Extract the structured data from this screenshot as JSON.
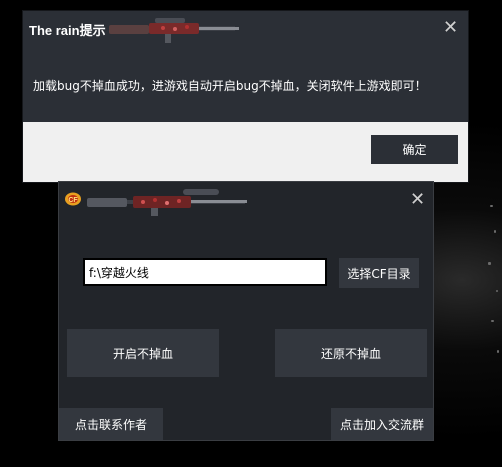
{
  "message_dialog": {
    "title": "The rain提示",
    "message": "加载bug不掉血成功，进游戏自动开启bug不掉血，关闭软件上游戏即可！",
    "ok_label": "确定",
    "close_symbol": "✕"
  },
  "tool_window": {
    "close_symbol": "✕",
    "path_value": "f:\\穿越火线",
    "select_dir_label": "选择CF目录",
    "enable_label": "开启不掉血",
    "restore_label": "还原不掉血",
    "contact_label": "点击联系作者",
    "join_group_label": "点击加入交流群"
  },
  "icons": {
    "title_gun": "sniper-rifle-icon",
    "cf_logo": "crossfire-logo-icon",
    "close": "close-icon"
  },
  "colors": {
    "dialog_bg": "#2b2f36",
    "dialog_footer": "#f0f0f0",
    "window_bg": "#22252a",
    "button_bg": "#33373e"
  }
}
